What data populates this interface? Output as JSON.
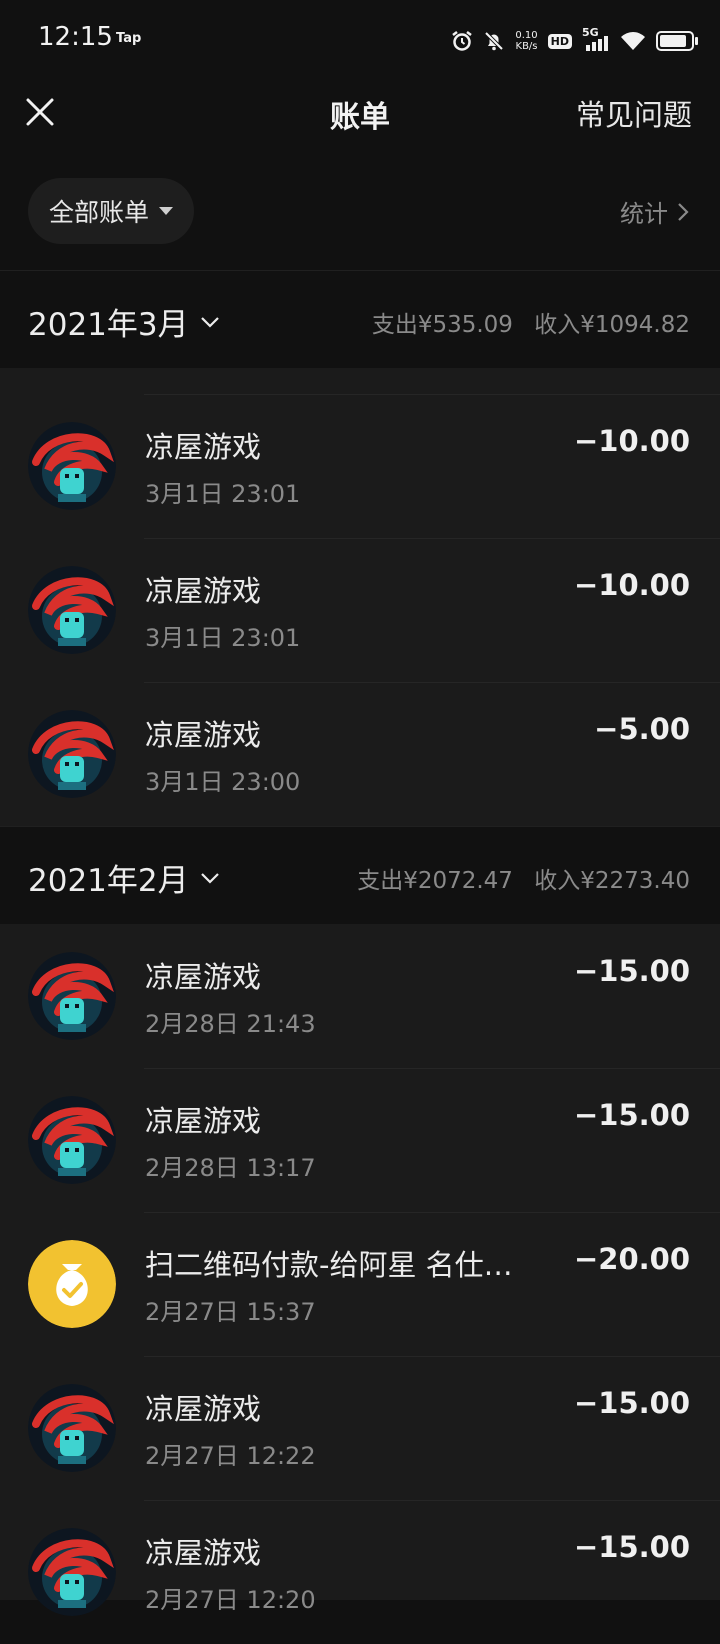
{
  "status_bar": {
    "time": "12:15",
    "notification": "Tap",
    "net_speed_value": "0.10",
    "net_speed_unit": "KB/s",
    "hd_badge": "HD",
    "network": "5G",
    "icons": [
      "alarm-icon",
      "mute-bell-icon",
      "signal-icon",
      "wifi-icon",
      "battery-icon"
    ]
  },
  "header": {
    "title": "账单",
    "faq_label": "常见问题",
    "close_icon": "close-icon"
  },
  "filter": {
    "label": "全部账单",
    "stats_label": "统计"
  },
  "months": [
    {
      "label": "2021年3月",
      "expense": "支出¥535.09",
      "income": "收入¥1094.82",
      "items": [
        {
          "name": "凉屋游戏",
          "time": "3月1日 23:01",
          "amount": "−10.00",
          "avatar": "game-avatar-icon"
        },
        {
          "name": "凉屋游戏",
          "time": "3月1日 23:01",
          "amount": "−10.00",
          "avatar": "game-avatar-icon"
        },
        {
          "name": "凉屋游戏",
          "time": "3月1日 23:00",
          "amount": "−5.00",
          "avatar": "game-avatar-icon"
        }
      ]
    },
    {
      "label": "2021年2月",
      "expense": "支出¥2072.47",
      "income": "收入¥2273.40",
      "items": [
        {
          "name": "凉屋游戏",
          "time": "2月28日 21:43",
          "amount": "−15.00",
          "avatar": "game-avatar-icon"
        },
        {
          "name": "凉屋游戏",
          "time": "2月28日 13:17",
          "amount": "−15.00",
          "avatar": "game-avatar-icon"
        },
        {
          "name": "扫二维码付款-给阿星 名仕…",
          "time": "2月27日 15:37",
          "amount": "−20.00",
          "avatar": "money-bag-icon"
        },
        {
          "name": "凉屋游戏",
          "time": "2月27日 12:22",
          "amount": "−15.00",
          "avatar": "game-avatar-icon"
        },
        {
          "name": "凉屋游戏",
          "time": "2月27日 12:20",
          "amount": "−15.00",
          "avatar": "game-avatar-icon"
        }
      ]
    }
  ],
  "colors": {
    "background": "#111111",
    "list_background": "#1b1b1b",
    "secondary_text": "#8a8a8a",
    "money_bag": "#f2c230"
  }
}
